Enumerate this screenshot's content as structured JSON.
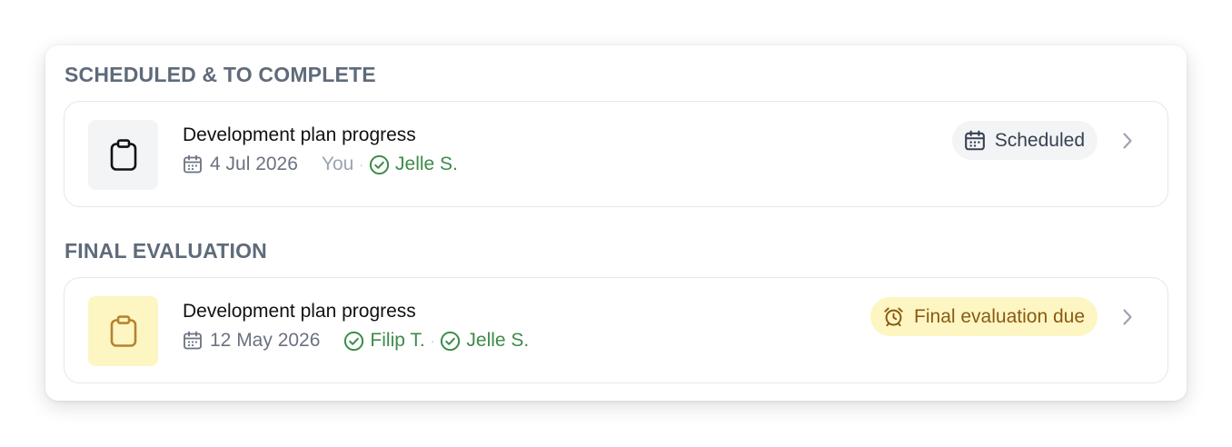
{
  "sections": [
    {
      "title": "SCHEDULED & TO COMPLETE",
      "cards": [
        {
          "title": "Development plan progress",
          "date": "4 Jul 2026",
          "you_label": "You",
          "people": [
            "Jelle S."
          ],
          "status": "Scheduled",
          "status_icon": "calendar-icon",
          "tile_icon": "clipboard-icon"
        }
      ]
    },
    {
      "title": "FINAL EVALUATION",
      "cards": [
        {
          "title": "Development plan progress",
          "date": "12 May 2026",
          "people": [
            "Filip T.",
            "Jelle S."
          ],
          "status": "Final evaluation due",
          "status_icon": "alarm-clock-icon",
          "tile_icon": "clipboard-icon"
        }
      ]
    }
  ],
  "separator": "·",
  "colors": {
    "section_title": "#5f6b7a",
    "person_done": "#3d8b4a",
    "scheduled_badge_bg": "#f3f4f6",
    "due_badge_bg": "#fdf6c3",
    "due_badge_text": "#8a5a12"
  }
}
